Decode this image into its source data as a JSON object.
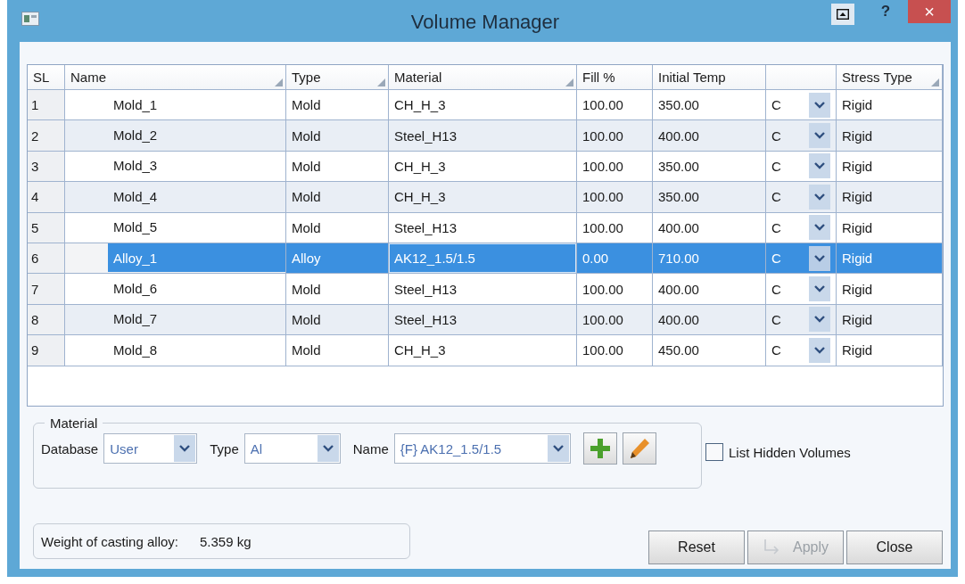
{
  "window": {
    "title": "Volume Manager",
    "help_label": "?",
    "close_label": "×"
  },
  "table": {
    "columns": [
      {
        "label": "SL",
        "sort_mark": false
      },
      {
        "label": "Name",
        "sort_mark": true
      },
      {
        "label": "Type",
        "sort_mark": true
      },
      {
        "label": "Material",
        "sort_mark": true
      },
      {
        "label": "Fill %",
        "sort_mark": false
      },
      {
        "label": "Initial Temp",
        "sort_mark": false
      },
      {
        "label": "Stress Type",
        "sort_mark": true
      }
    ],
    "rows": [
      {
        "sl": "1",
        "name": "Mold_1",
        "type": "Mold",
        "material": "CH_H_3",
        "fill": "100.00",
        "initial_temp": "350.00",
        "unit": "C",
        "stress_type": "Rigid",
        "selected": false
      },
      {
        "sl": "2",
        "name": "Mold_2",
        "type": "Mold",
        "material": "Steel_H13",
        "fill": "100.00",
        "initial_temp": "400.00",
        "unit": "C",
        "stress_type": "Rigid",
        "selected": false
      },
      {
        "sl": "3",
        "name": "Mold_3",
        "type": "Mold",
        "material": "CH_H_3",
        "fill": "100.00",
        "initial_temp": "350.00",
        "unit": "C",
        "stress_type": "Rigid",
        "selected": false
      },
      {
        "sl": "4",
        "name": "Mold_4",
        "type": "Mold",
        "material": "CH_H_3",
        "fill": "100.00",
        "initial_temp": "350.00",
        "unit": "C",
        "stress_type": "Rigid",
        "selected": false
      },
      {
        "sl": "5",
        "name": "Mold_5",
        "type": "Mold",
        "material": "Steel_H13",
        "fill": "100.00",
        "initial_temp": "400.00",
        "unit": "C",
        "stress_type": "Rigid",
        "selected": false
      },
      {
        "sl": "6",
        "name": "Alloy_1",
        "type": "Alloy",
        "material": "AK12_1.5/1.5",
        "fill": "0.00",
        "initial_temp": "710.00",
        "unit": "C",
        "stress_type": "Rigid",
        "selected": true
      },
      {
        "sl": "7",
        "name": "Mold_6",
        "type": "Mold",
        "material": "Steel_H13",
        "fill": "100.00",
        "initial_temp": "400.00",
        "unit": "C",
        "stress_type": "Rigid",
        "selected": false
      },
      {
        "sl": "8",
        "name": "Mold_7",
        "type": "Mold",
        "material": "Steel_H13",
        "fill": "100.00",
        "initial_temp": "400.00",
        "unit": "C",
        "stress_type": "Rigid",
        "selected": false
      },
      {
        "sl": "9",
        "name": "Mold_8",
        "type": "Mold",
        "material": "CH_H_3",
        "fill": "100.00",
        "initial_temp": "450.00",
        "unit": "C",
        "stress_type": "Rigid",
        "selected": false
      }
    ]
  },
  "material_group": {
    "legend": "Material",
    "fields": [
      {
        "label": "Database",
        "value": "User"
      },
      {
        "label": "Type",
        "value": "Al"
      },
      {
        "label": "Name",
        "value": "{F} AK12_1.5/1.5"
      }
    ]
  },
  "list_hidden_volumes": {
    "label": "List Hidden Volumes",
    "checked": false
  },
  "weight": {
    "label": "Weight of casting alloy:",
    "value": "5.359 kg"
  },
  "buttons": [
    {
      "label": "Reset",
      "disabled": false
    },
    {
      "label": "Apply",
      "disabled": true
    },
    {
      "label": "Close",
      "disabled": false
    }
  ]
}
